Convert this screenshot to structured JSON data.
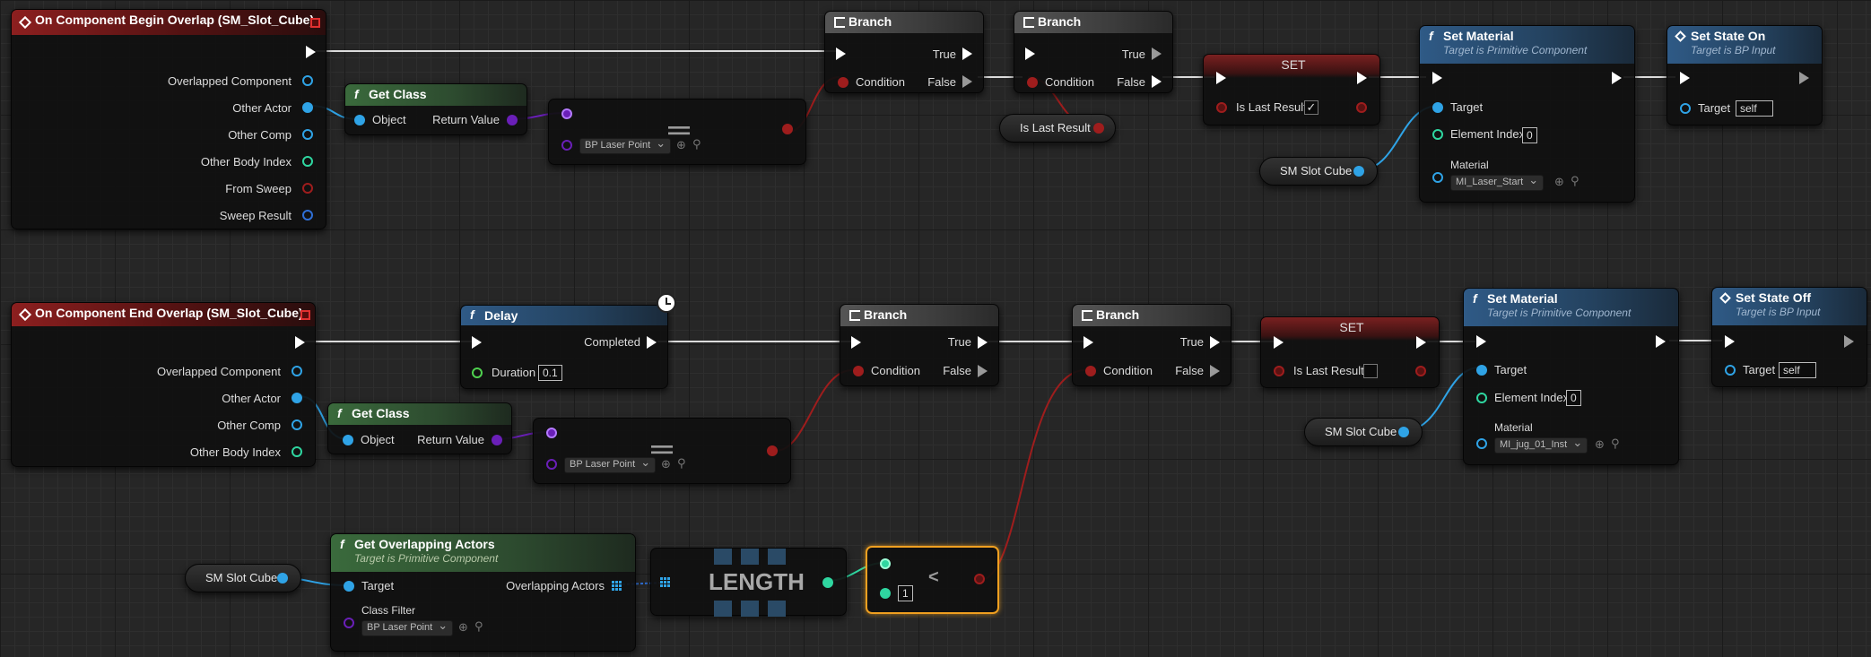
{
  "colors": {
    "exec": "#ffffff",
    "object_pin": "#2fa3e6",
    "class_pin": "#6a1fb8",
    "bool_pin": "#9e1d1d",
    "int_pin": "#2fd6a0",
    "float_pin": "#4fd14f",
    "struct_pin": "#2f6fd6",
    "event_header": "#8c1f1f",
    "pure_header": "#3a6a3c",
    "function_header": "#2f5a86",
    "selected_outline": "#f0a020"
  },
  "row1": {
    "event": {
      "title": "On Component Begin Overlap (SM_Slot_Cube)",
      "pins": [
        "Overlapped Component",
        "Other Actor",
        "Other Comp",
        "Other Body Index",
        "From Sweep",
        "Sweep Result"
      ]
    },
    "get_class": {
      "title": "Get Class",
      "in_label": "Object",
      "out_label": "Return Value"
    },
    "equal": {
      "op": "==",
      "class_value": "BP Laser Point"
    },
    "branch1": {
      "title": "Branch",
      "condition": "Condition",
      "true": "True",
      "false": "False"
    },
    "branch2": {
      "title": "Branch",
      "condition": "Condition",
      "true": "True",
      "false": "False"
    },
    "is_last_var": {
      "label": "Is Last Result"
    },
    "set": {
      "title": "SET",
      "label": "Is Last Result",
      "checked": "✓"
    },
    "cube_var": {
      "label": "SM Slot Cube"
    },
    "set_material": {
      "title": "Set Material",
      "subtitle": "Target is Primitive Component",
      "target": "Target",
      "element_index_label": "Element Index",
      "element_index": "0",
      "material_label": "Material",
      "material": "MI_Laser_Start"
    },
    "set_state": {
      "title": "Set State On",
      "subtitle": "Target is BP Input",
      "target": "Target",
      "target_value": "self"
    }
  },
  "row2": {
    "event": {
      "title": "On Component End Overlap (SM_Slot_Cube)",
      "pins": [
        "Overlapped Component",
        "Other Actor",
        "Other Comp",
        "Other Body Index"
      ]
    },
    "delay": {
      "title": "Delay",
      "completed": "Completed",
      "duration_label": "Duration",
      "duration": "0.1"
    },
    "get_class": {
      "title": "Get Class",
      "in_label": "Object",
      "out_label": "Return Value"
    },
    "equal": {
      "op": "==",
      "class_value": "BP Laser Point"
    },
    "branch1": {
      "title": "Branch",
      "condition": "Condition",
      "true": "True",
      "false": "False"
    },
    "branch2": {
      "title": "Branch",
      "condition": "Condition",
      "true": "True",
      "false": "False"
    },
    "set": {
      "title": "SET",
      "label": "Is Last Result"
    },
    "cube_var": {
      "label": "SM Slot Cube"
    },
    "set_material": {
      "title": "Set Material",
      "subtitle": "Target is Primitive Component",
      "target": "Target",
      "element_index_label": "Element Index",
      "element_index": "0",
      "material_label": "Material",
      "material": "MI_jug_01_Inst"
    },
    "set_state": {
      "title": "Set State Off",
      "subtitle": "Target is BP Input",
      "target": "Target",
      "target_value": "self"
    }
  },
  "row3": {
    "cube_var": {
      "label": "SM Slot Cube"
    },
    "overlapping": {
      "title": "Get Overlapping Actors",
      "subtitle": "Target is Primitive Component",
      "target": "Target",
      "out_label": "Overlapping Actors",
      "filter_label": "Class Filter",
      "filter_value": "BP Laser Point"
    },
    "length": {
      "label": "LENGTH"
    },
    "less": {
      "op": "<",
      "value": "1"
    }
  }
}
